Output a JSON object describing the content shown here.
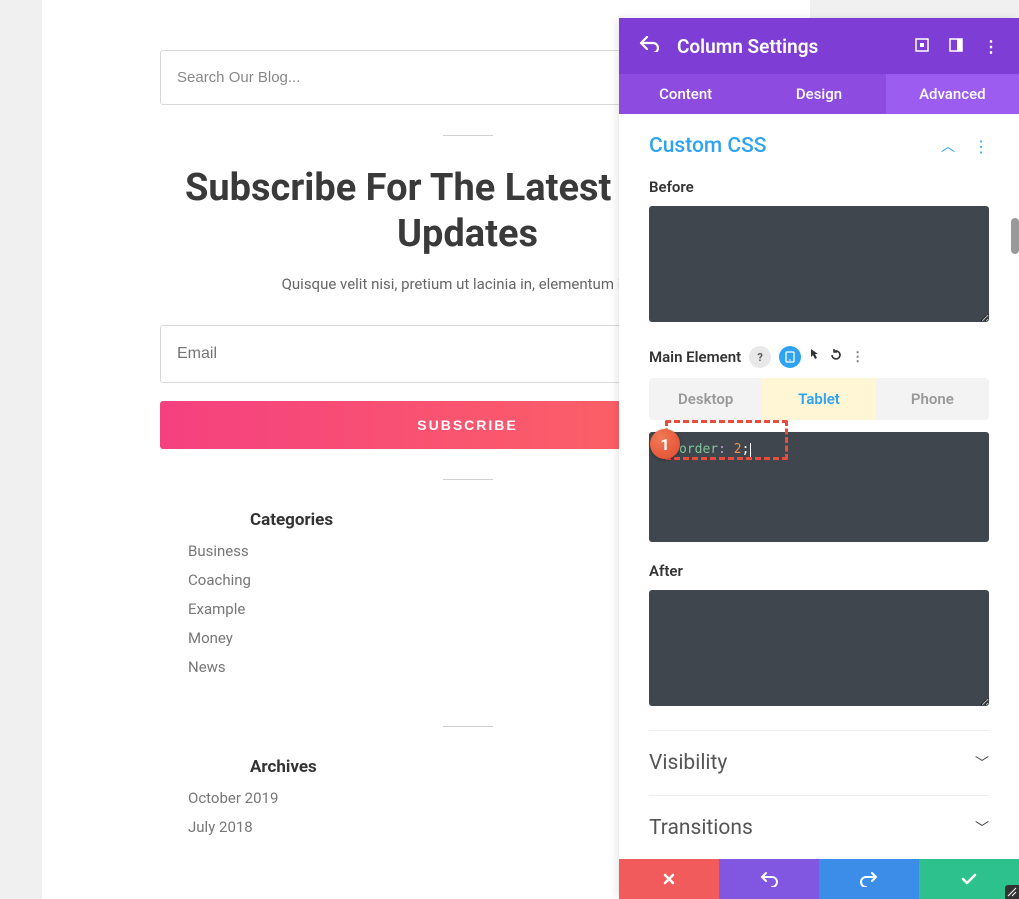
{
  "page": {
    "search_placeholder": "Search Our Blog...",
    "headline": "Subscribe For The Latest News & Updates",
    "subtext": "Quisque velit nisi, pretium ut lacinia in, elementum id eni",
    "email_placeholder": "Email",
    "subscribe_label": "SUBSCRIBE",
    "categories_title": "Categories",
    "categories": [
      "Business",
      "Coaching",
      "Example",
      "Money",
      "News"
    ],
    "archives_title": "Archives",
    "archives": [
      "October 2019",
      "July 2018"
    ]
  },
  "panel": {
    "title": "Column Settings",
    "tabs": {
      "content": "Content",
      "design": "Design",
      "advanced": "Advanced"
    },
    "section_css": "Custom CSS",
    "before_label": "Before",
    "main_element_label": "Main Element",
    "devices": {
      "desktop": "Desktop",
      "tablet": "Tablet",
      "phone": "Phone"
    },
    "code": {
      "prop": "order",
      "colon": ":",
      "value": "2",
      "semi": ";"
    },
    "after_label": "After",
    "section_visibility": "Visibility",
    "section_transitions": "Transitions",
    "annotation_number": "1"
  }
}
